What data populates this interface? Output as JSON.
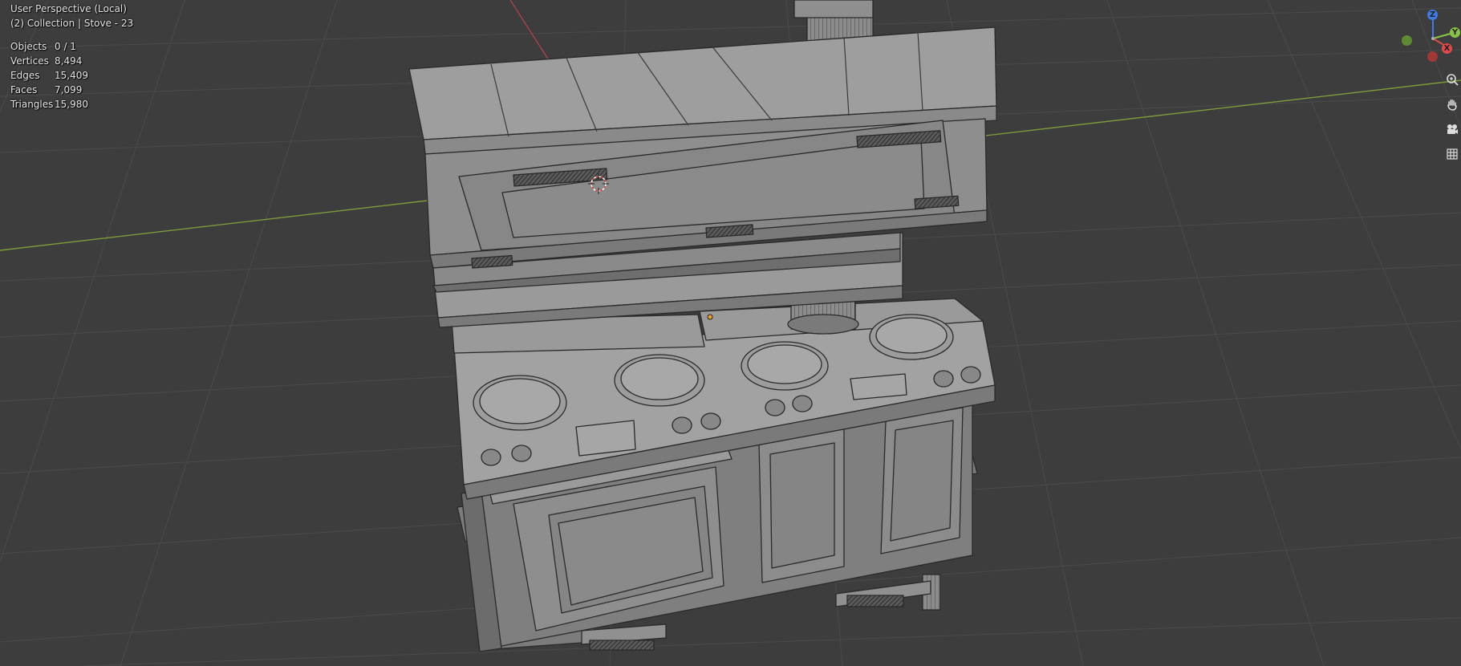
{
  "viewport": {
    "view_name": "User Perspective (Local)",
    "collection_info": "(2) Collection | Stove - 23",
    "background": "#3d3d3d",
    "grid_color": "#474747",
    "x_axis_color": "#7d9b3c",
    "y_axis_color": "#a84444"
  },
  "stats": [
    {
      "label": "Objects",
      "value": "0 / 1"
    },
    {
      "label": "Vertices",
      "value": "8,494"
    },
    {
      "label": "Edges",
      "value": "15,409"
    },
    {
      "label": "Faces",
      "value": "7,099"
    },
    {
      "label": "Triangles",
      "value": "15,980"
    }
  ],
  "gizmo": {
    "axes": [
      {
        "name": "Z",
        "color": "#3f7be0"
      },
      {
        "name": "Y",
        "color": "#8bc34a"
      },
      {
        "name": "X",
        "color": "#e04a4a"
      }
    ]
  },
  "nav_tools": [
    {
      "name": "zoom-icon"
    },
    {
      "name": "pan-hand-icon"
    },
    {
      "name": "camera-icon"
    },
    {
      "name": "grid-ortho-icon"
    }
  ],
  "model": {
    "name": "Stove",
    "body_color": "#8a8a8a",
    "light_color": "#a0a0a0",
    "dark_color": "#6c6c6c",
    "wire_color": "#2a2a2a"
  }
}
